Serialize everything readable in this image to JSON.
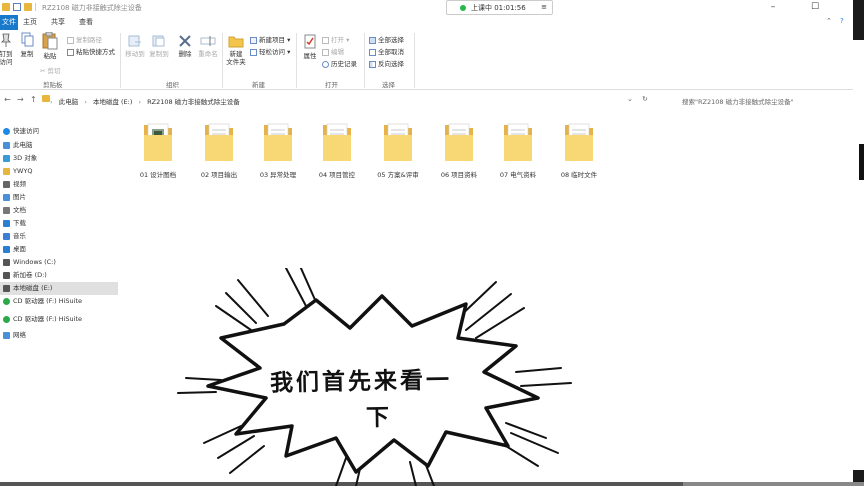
{
  "window": {
    "title": "RZ2108 磁力非接触式除尘设备",
    "recording_label": "上课中 01:01:56",
    "recording_dot_color": "#28b84a"
  },
  "tabs": [
    {
      "label": "文件",
      "active": true
    },
    {
      "label": "主页"
    },
    {
      "label": "共享"
    },
    {
      "label": "查看"
    }
  ],
  "ribbon": {
    "clipboard": {
      "label": "剪贴板",
      "pin": "固定到快速访问",
      "copy": "复制",
      "paste": "粘贴",
      "copy_path": "复制路径",
      "paste_shortcut": "粘贴快捷方式",
      "cut": "剪切"
    },
    "organize": {
      "label": "组织",
      "move_to": "移动到",
      "copy_to": "复制到",
      "delete": "删除",
      "rename": "重命名"
    },
    "new": {
      "label": "新建",
      "new_folder": "新建文件夹",
      "new_item": "新建项目",
      "easy_access": "轻松访问"
    },
    "open": {
      "label": "打开",
      "properties": "属性",
      "open": "打开",
      "edit": "编辑",
      "history": "历史记录"
    },
    "select": {
      "label": "选择",
      "select_all": "全部选择",
      "select_none": "全部取消",
      "invert": "反向选择"
    }
  },
  "address": {
    "crumbs": [
      "此电脑",
      "本地磁盘 (E:)",
      "RZ2108 磁力非接触式除尘设备"
    ],
    "search_placeholder": "搜索\"RZ2108 磁力非接触式除尘设备\""
  },
  "nav": [
    {
      "label": "快速访问",
      "icon": "star-icon",
      "color": "#1e88e5"
    },
    {
      "label": "此电脑",
      "icon": "computer-icon",
      "color": "#4a90d9"
    },
    {
      "label": "3D 对象",
      "icon": "cube-icon",
      "color": "#3a9bd9"
    },
    {
      "label": "YWYQ",
      "icon": "folder-icon",
      "color": "#e6b73c"
    },
    {
      "label": "视频",
      "icon": "video-icon",
      "color": "#666666"
    },
    {
      "label": "图片",
      "icon": "picture-icon",
      "color": "#4a90d9"
    },
    {
      "label": "文档",
      "icon": "document-icon",
      "color": "#777777"
    },
    {
      "label": "下载",
      "icon": "download-icon",
      "color": "#2a7fd4"
    },
    {
      "label": "音乐",
      "icon": "music-icon",
      "color": "#3a7fd4"
    },
    {
      "label": "桌面",
      "icon": "desktop-icon",
      "color": "#2a7fd4"
    },
    {
      "label": "Windows (C:)",
      "icon": "drive-c-icon",
      "color": "#555555"
    },
    {
      "label": "新加卷 (D:)",
      "icon": "drive-icon",
      "color": "#555555"
    },
    {
      "label": "本地磁盘 (E:)",
      "icon": "drive-icon",
      "color": "#555555",
      "selected": true
    },
    {
      "label": "CD 驱动器 (F:) HiSuite",
      "icon": "hisuite-icon",
      "color": "#2aa84a"
    },
    {
      "label": "CD 驱动器 (F:) HiSuite",
      "icon": "hisuite-icon",
      "color": "#2aa84a"
    },
    {
      "label": "网络",
      "icon": "network-icon",
      "color": "#4a90d9"
    }
  ],
  "folders": [
    {
      "label": "01 设计图档",
      "has_preview": true
    },
    {
      "label": "02 项目输出"
    },
    {
      "label": "03 异常处理"
    },
    {
      "label": "04 项目管控"
    },
    {
      "label": "05 方案&评审"
    },
    {
      "label": "06 项目资料"
    },
    {
      "label": "07 电气资料"
    },
    {
      "label": "08 临时文件"
    }
  ],
  "overlay": {
    "line1": "我们首先来看一",
    "line2": "下"
  }
}
